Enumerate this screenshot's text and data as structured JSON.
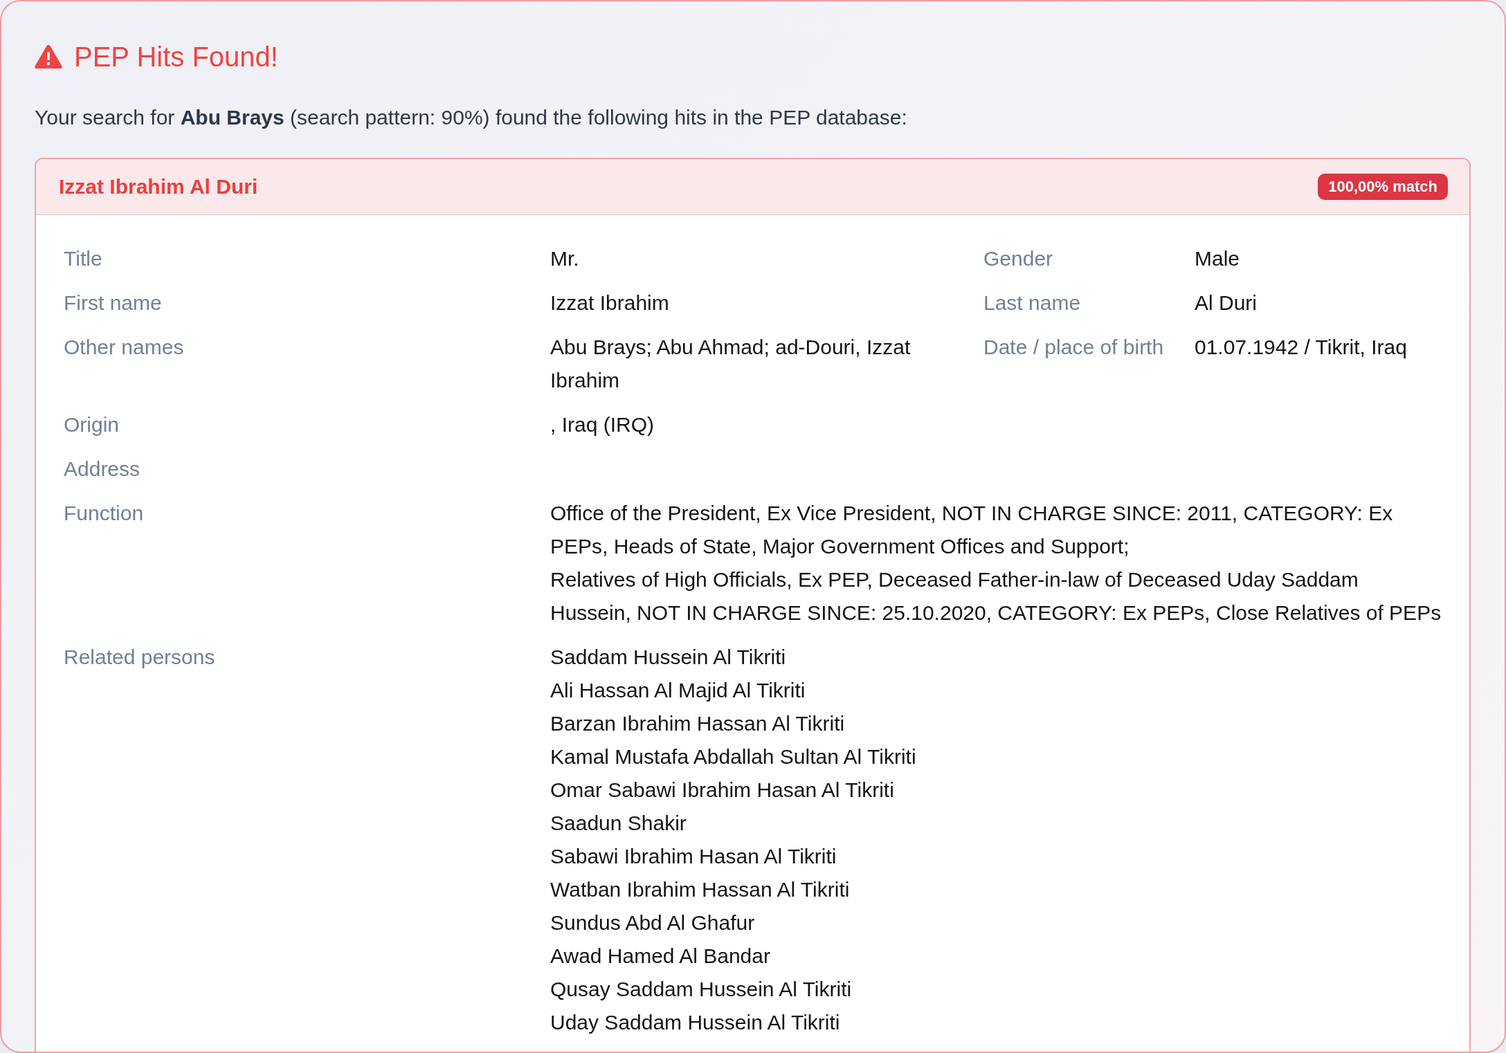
{
  "alert": {
    "title": "PEP Hits Found!"
  },
  "summary": "Your search for **Abu Brays** (search pattern: 90%) found the following hits in the PEP database:",
  "hits": [
    {
      "name": "Izzat Ibrahim Al Duri",
      "match": "100,00% match",
      "rows": [
        {
          "kind": "pair",
          "fields": [
            {
              "label": "Title",
              "value": "Mr."
            },
            {
              "label": "Gender",
              "value": "Male"
            }
          ]
        },
        {
          "kind": "pair",
          "fields": [
            {
              "label": "First name",
              "value": "Izzat Ibrahim"
            },
            {
              "label": "Last name",
              "value": "Al Duri"
            }
          ]
        },
        {
          "kind": "pair",
          "fields": [
            {
              "label": "Other names",
              "value": "Abu Brays; Abu Ahmad; ad-Douri, Izzat Ibrahim"
            },
            {
              "label": "Date / place of birth",
              "value": "01.07.1942 / Tikrit, Iraq"
            }
          ]
        },
        {
          "kind": "single",
          "label": "Origin",
          "value": ", Iraq (IRQ)"
        },
        {
          "kind": "single",
          "label": "Address"
        },
        {
          "kind": "paragraphs",
          "label": "Function",
          "lines": [
            "Office of the President, Ex Vice President, NOT IN CHARGE SINCE: 2011, CATEGORY: Ex PEPs, Heads of State, Major Government Offices and Support;",
            "Relatives of High Officials, Ex PEP, Deceased Father-in-law of Deceased Uday Saddam Hussein, NOT IN CHARGE SINCE: 25.10.2020, CATEGORY: Ex PEPs, Close Relatives of PEPs"
          ]
        },
        {
          "kind": "list",
          "label": "Related persons",
          "lines": [
            "Saddam Hussein Al Tikriti",
            "Ali Hassan Al Majid Al Tikriti",
            "Barzan Ibrahim Hassan Al Tikriti",
            "Kamal Mustafa Abdallah Sultan Al Tikriti",
            "Omar Sabawi Ibrahim Hasan Al Tikriti",
            "Saadun Shakir",
            "Sabawi Ibrahim Hasan Al Tikriti",
            "Watban Ibrahim Hassan Al Tikriti",
            "Sundus Abd Al Ghafur",
            "Awad Hamed Al Bandar",
            "Qusay Saddam Hussein Al Tikriti",
            "Uday Saddam Hussein Al Tikriti"
          ]
        }
      ]
    }
  ]
}
